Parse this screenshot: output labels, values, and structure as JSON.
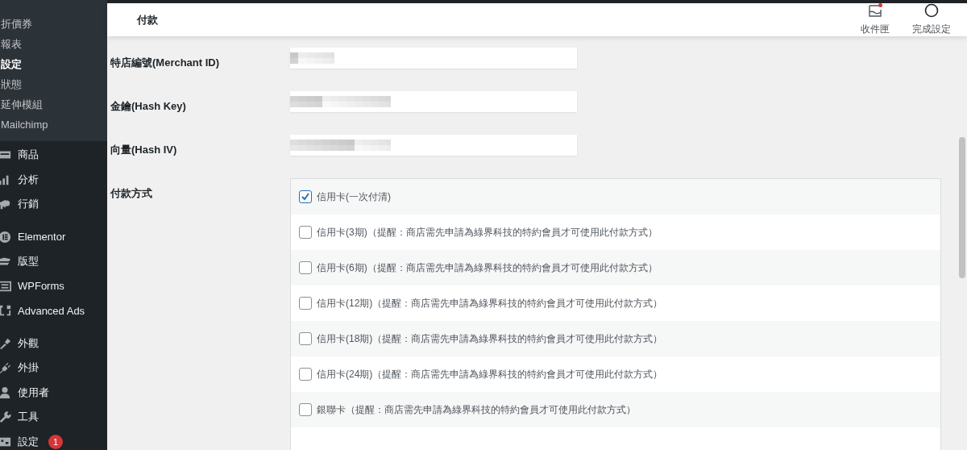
{
  "sidebar": {
    "submenu": [
      {
        "label": "折價券",
        "selected": false
      },
      {
        "label": "報表",
        "selected": false
      },
      {
        "label": "設定",
        "selected": true
      },
      {
        "label": "狀態",
        "selected": false
      },
      {
        "label": "延伸模組",
        "selected": false
      },
      {
        "label": "Mailchimp",
        "selected": false
      }
    ],
    "menu_groups": [
      [
        {
          "label": "商品"
        },
        {
          "label": "分析"
        },
        {
          "label": "行銷"
        }
      ],
      [
        {
          "label": "Elementor"
        },
        {
          "label": "版型"
        },
        {
          "label": "WPForms"
        },
        {
          "label": "Advanced Ads"
        }
      ],
      [
        {
          "label": "外觀"
        },
        {
          "label": "外掛"
        },
        {
          "label": "使用者"
        },
        {
          "label": "工具"
        },
        {
          "label": "設定",
          "badge": "1"
        }
      ]
    ]
  },
  "header": {
    "title": "付款",
    "actions": [
      {
        "label": "收件匣",
        "unread": true
      },
      {
        "label": "完成設定"
      }
    ]
  },
  "fields": [
    {
      "label": "特店編號(Merchant ID)"
    },
    {
      "label": "金鑰(Hash Key)"
    },
    {
      "label": "向量(Hash IV)"
    }
  ],
  "payment_methods": {
    "label": "付款方式",
    "options": [
      {
        "label": "信用卡(一次付清)",
        "checked": true
      },
      {
        "label": "信用卡(3期)（提醒：商店需先申請為綠界科技的特約會員才可使用此付款方式）",
        "checked": false
      },
      {
        "label": "信用卡(6期)（提醒：商店需先申請為綠界科技的特約會員才可使用此付款方式）",
        "checked": false
      },
      {
        "label": "信用卡(12期)（提醒：商店需先申請為綠界科技的特約會員才可使用此付款方式）",
        "checked": false
      },
      {
        "label": "信用卡(18期)（提醒：商店需先申請為綠界科技的特約會員才可使用此付款方式）",
        "checked": false
      },
      {
        "label": "信用卡(24期)（提醒：商店需先申請為綠界科技的特約會員才可使用此付款方式）",
        "checked": false
      },
      {
        "label": "銀聯卡（提醒：商店需先申請為綠界科技的特約會員才可使用此付款方式）",
        "checked": false
      }
    ]
  }
}
